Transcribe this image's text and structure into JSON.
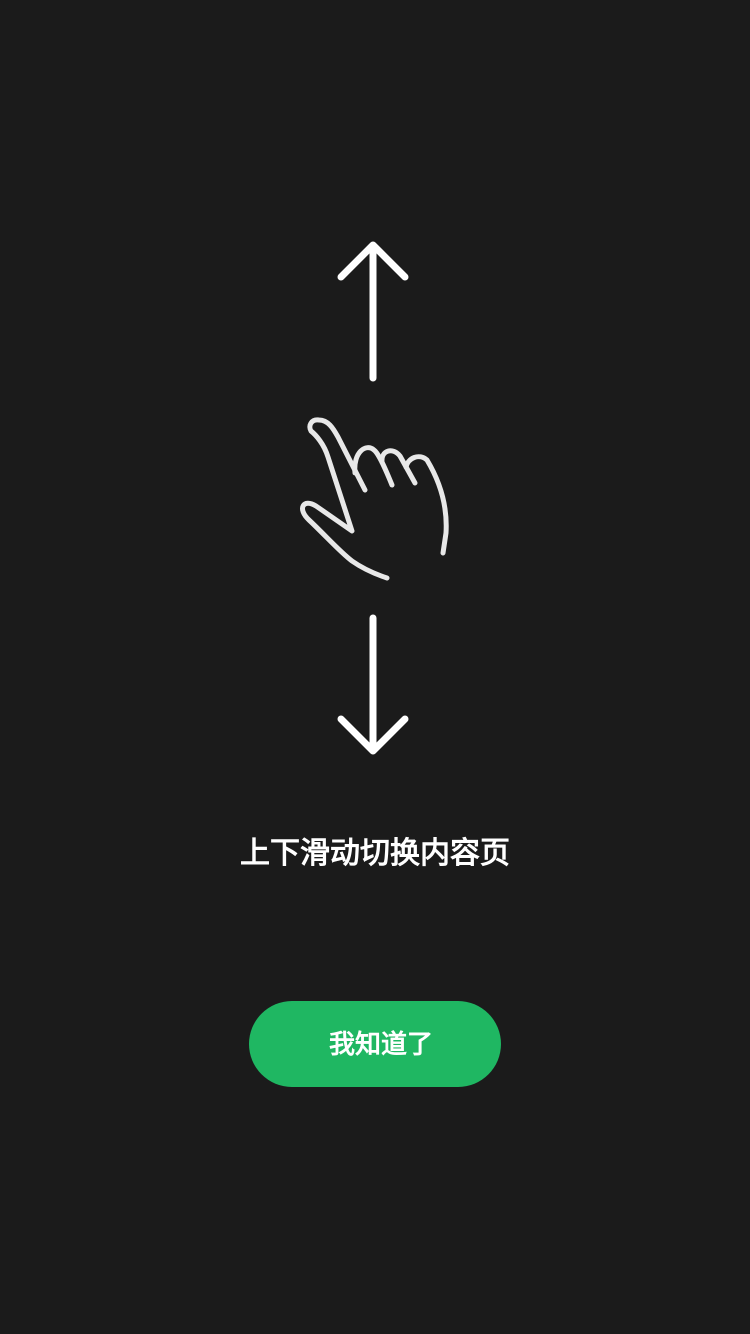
{
  "guide": {
    "hint_text": "上下滑动切换内容页",
    "confirm_button_label": "我知道了"
  },
  "icons": {
    "up": "arrow-up-icon",
    "hand": "swipe-hand-icon",
    "down": "arrow-down-icon"
  },
  "colors": {
    "background": "#1b1b1b",
    "button": "#1fb762",
    "text": "#ffffff",
    "hand_outline": "#e8e8e8"
  }
}
